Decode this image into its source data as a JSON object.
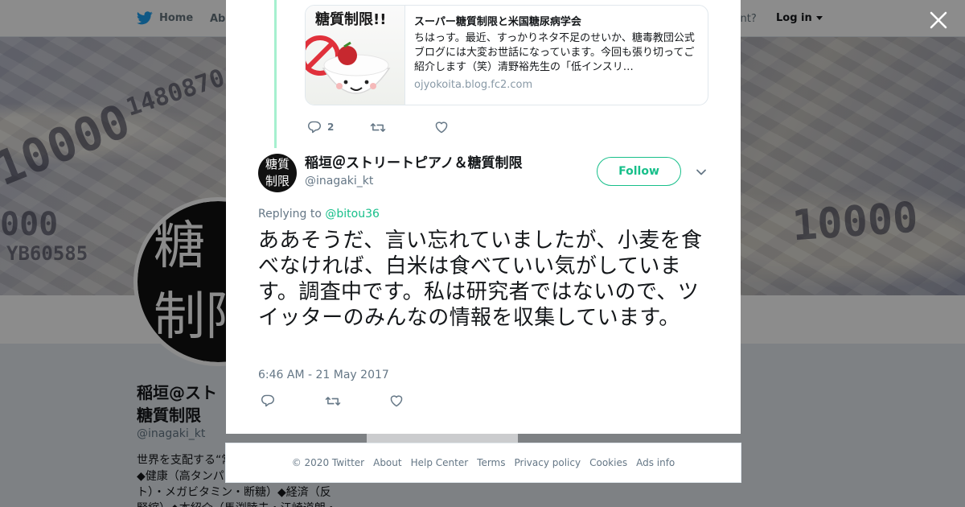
{
  "nav": {
    "home": "Home",
    "about": "Abo",
    "account": "ccount?",
    "login": "Log in"
  },
  "background_profile": {
    "avatar_text_1": "糖",
    "avatar_text_2": "制限",
    "name_line_1": "稲垣@スト",
    "name_line_2": "糖質制限",
    "handle": "@inagaki_kt",
    "bio_line_1": "世界を支配する“常",
    "bio_line_2": "◆健康（高タンパ",
    "bio_line_3": "ト）・メガビタミン・断糖）◆経済（反",
    "bio_line_4": "緊縮）◆本紹介（馬渕睦夫・江崎道朗・",
    "banner_numbers": [
      "1480870",
      "10000",
      "YB60585",
      "10000",
      "000"
    ]
  },
  "card": {
    "image_caption": "糖質制限!!",
    "title": "スーパー糖質制限と米国糖尿病学会",
    "description": "ちはっす。最近、すっかりネタ不足のせいか、糖毒教団公式ブログには大変お世話になっています。今回も張り切ってご紹介します（笑）清野裕先生の「低インスリ…",
    "domain": "ojyokoita.blog.fc2.com"
  },
  "prev_actions": {
    "reply_count": "2"
  },
  "tweet": {
    "avatar_line_1": "糖質",
    "avatar_line_2": "制限",
    "author_name": "稲垣＠ストリートピアノ＆糖質制限",
    "author_handle": "@inagaki_kt",
    "follow_label": "Follow",
    "replying_prefix": "Replying to",
    "replying_to": "@bitou36",
    "text": "ああそうだ、言い忘れていましたが、小麦を食べなければ、白米は食べていい気がしています。調査中です。私は研究者ではないので、ツイッターのみんなの情報を収集しています。",
    "timestamp": "6:46 AM - 21 May 2017"
  },
  "footer": {
    "copyright": "© 2020 Twitter",
    "about": "About",
    "help": "Help Center",
    "terms": "Terms",
    "privacy": "Privacy policy",
    "cookies": "Cookies",
    "ads": "Ads info"
  },
  "colors": {
    "accent": "#17bf8a",
    "thread_line": "#a6f0cf",
    "twitter_blue": "#1da1f2",
    "overlay": "rgba(0,0,0,0.45)"
  },
  "icons": [
    "twitter-bird-icon",
    "caret-down-icon",
    "close-icon",
    "reply-icon",
    "retweet-icon",
    "like-icon",
    "chevron-down-icon"
  ]
}
